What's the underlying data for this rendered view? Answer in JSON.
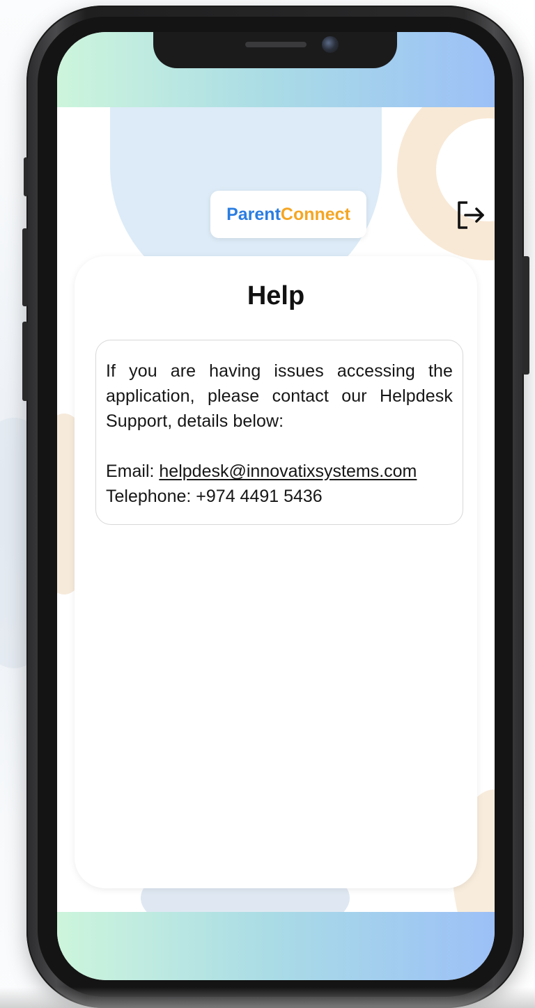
{
  "header": {
    "logo_part_1": "Parent",
    "logo_part_2": "Connect",
    "logout_icon": "logout-icon"
  },
  "help": {
    "title": "Help",
    "message": "If you are having issues accessing the application, please contact our Helpdesk Support, details below:",
    "email_label": "Email: ",
    "email_value": "helpdesk@innovatixsystems.com",
    "telephone_label": "Telephone: ",
    "telephone_value": "+974 4491 5436"
  },
  "colors": {
    "logo_blue": "#2a7de1",
    "logo_orange": "#f5a623",
    "gradient_start": "#cdf5dc",
    "gradient_end": "#9cc0f7"
  }
}
